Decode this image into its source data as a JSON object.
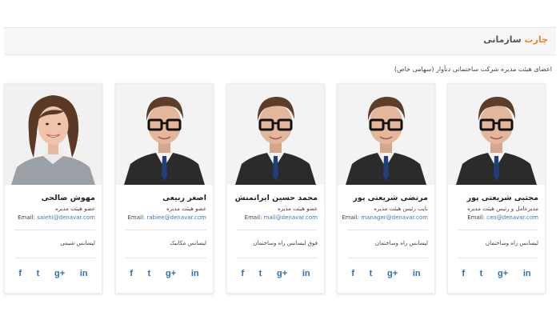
{
  "header": {
    "title_part1": "چارت",
    "title_part2": "سازمانی",
    "subtitle": "اعضای هیئت مدیره شرکت ساختمانی دنآوار (سهامی خاص)"
  },
  "email_label": "Email:",
  "social": {
    "facebook": "f",
    "twitter": "t",
    "googleplus": "g+",
    "linkedin": "in"
  },
  "members": [
    {
      "name": "مجتبی شریعتی پور",
      "role": "مدیرعامل و رئیس هیئت مدیره",
      "email": "ceo@denavar.com",
      "degree": "لیسانس راه وساختمان",
      "photo": "male"
    },
    {
      "name": "مرتضی شریعتی پور",
      "role": "نایب رئیس هیئت مدیره",
      "email": "manager@denavar.com",
      "degree": "لیسانس راه وساختمان",
      "photo": "male"
    },
    {
      "name": "محمد حسین ایرانمنش",
      "role": "عضو هیئت مدیره",
      "email": "mail@denavar.com",
      "degree": "فوق لیسانس راه وساختمان",
      "photo": "male"
    },
    {
      "name": "اصغر ربیعی",
      "role": "عضو هیئت مدیره",
      "email": "rabiee@denavar.com",
      "degree": "لیسانس مکانیک",
      "photo": "male"
    },
    {
      "name": "مهوش صالحی",
      "role": "عضو هیئت مدیره",
      "email": "salehi@denavar.com",
      "degree": "لیسانس شیمی",
      "photo": "female"
    }
  ],
  "colors": {
    "accent": "#e08a2e",
    "link": "#3a7ab8",
    "social": "#2d6fb0"
  }
}
